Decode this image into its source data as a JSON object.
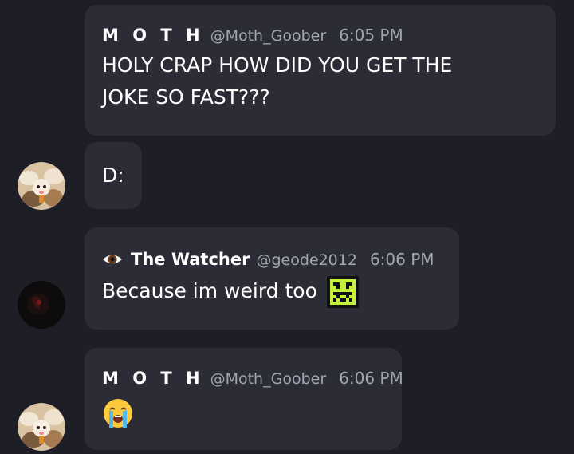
{
  "messages": [
    {
      "author": "M O T H",
      "handle": "@Moth_Goober",
      "time": "6:05 PM",
      "lines": [
        "HOLY CRAP HOW DID YOU GET THE",
        "JOKE SO FAST???"
      ]
    },
    {
      "text": "D:"
    },
    {
      "author": "The Watcher",
      "handle": "@geode2012",
      "time": "6:06 PM",
      "text": "Because im weird too",
      "inline_emoji": "pixel-creature-emoji"
    },
    {
      "author": "M O T H",
      "handle": "@Moth_Goober",
      "time": "6:06 PM",
      "emoji": "loudly-crying-face"
    }
  ],
  "colors": {
    "background": "#1e1f26",
    "bubble": "#2b2c35",
    "muted_text": "#a3a6b0",
    "emoji_green": "#c4f23a"
  }
}
